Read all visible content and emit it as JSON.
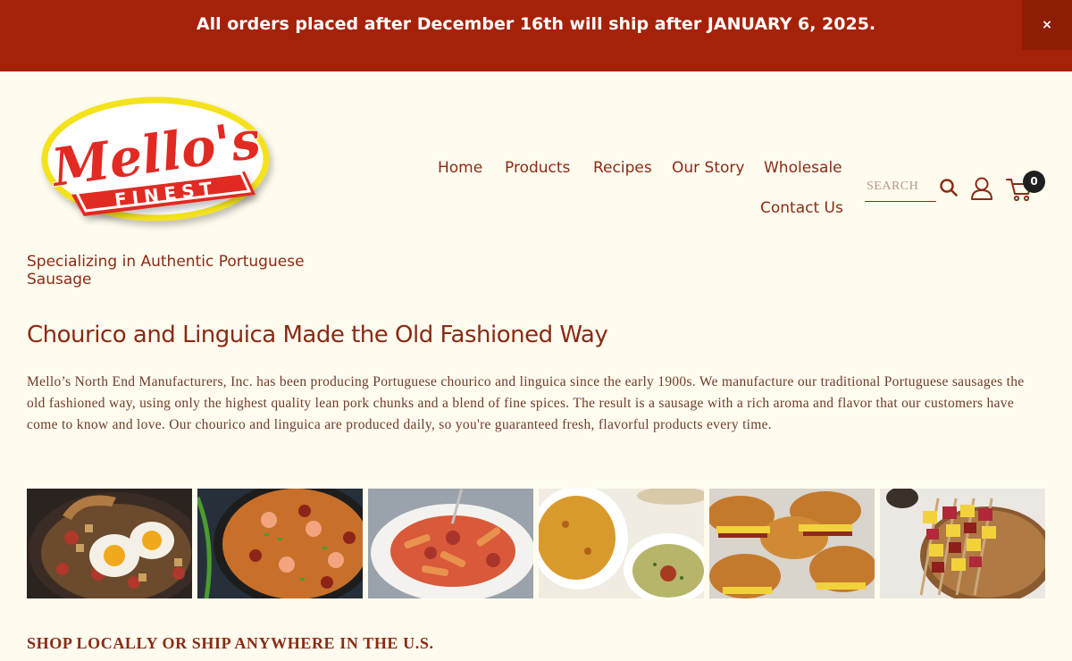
{
  "announcement": {
    "text": "All orders placed after  December 16th will ship after JANUARY 6, 2025.",
    "close_label": "×"
  },
  "brand": {
    "logo_text": "Mello's",
    "logo_subtext": "FINEST",
    "tagline": "Specializing in Authentic Portuguese Sausage"
  },
  "nav": {
    "items": [
      "Home",
      "Products",
      "Recipes",
      "Our Story",
      "Wholesale",
      "Contact Us"
    ]
  },
  "search": {
    "placeholder": "SEARCH"
  },
  "cart": {
    "count": "0"
  },
  "icons": [
    "search-icon",
    "account-icon",
    "cart-icon",
    "close-icon"
  ],
  "main": {
    "headline": "Chourico and Linguica Made the Old Fashioned Way",
    "intro": "Mello’s North End Manufacturers, Inc. has been producing Portuguese chourico and linguica since the early 1900s. We manufacture our traditional Portuguese sausages the old fashioned way, using only the highest quality lean pork chunks and a blend of fine spices. The result is a sausage with a rich aroma and flavor that our customers have come to know and love. Our chourico and linguica are produced daily, so you're guaranteed fresh, flavorful products every time.",
    "shop_heading": "SHOP LOCALLY OR SHIP ANYWHERE IN THE U.S."
  },
  "colors": {
    "brand_red": "#a52208",
    "text_brown": "#8a2a14",
    "background": "#fffcef",
    "logo_yellow": "#f4e21c",
    "logo_red": "#e02a22"
  }
}
